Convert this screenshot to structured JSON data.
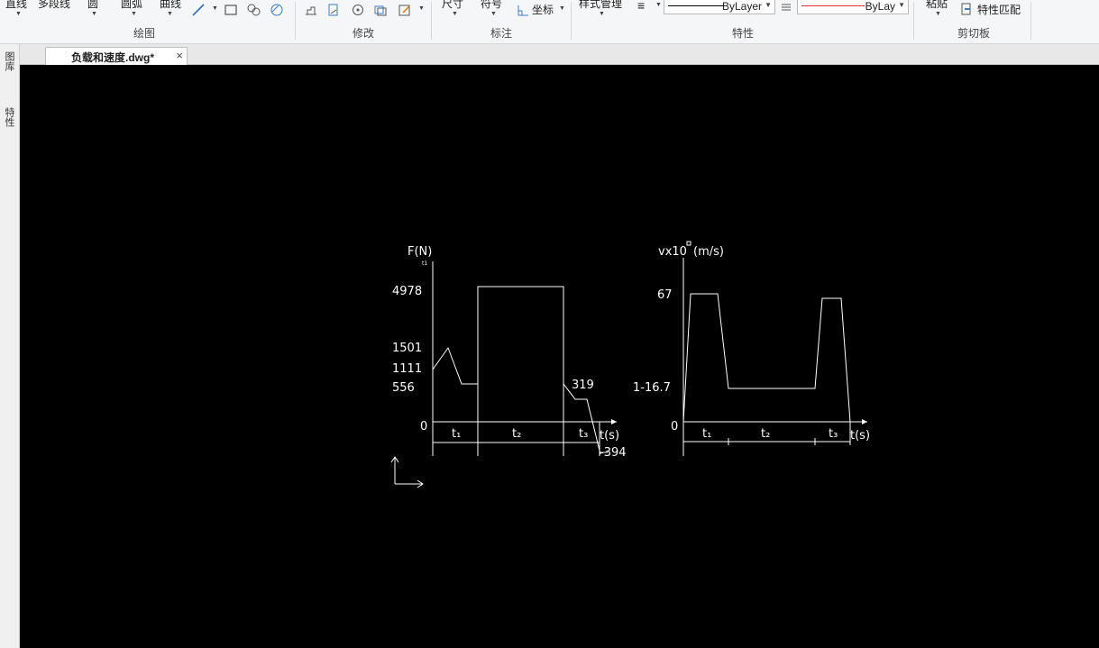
{
  "ribbon": {
    "draw_items": [
      "直线",
      "多段线",
      "圆",
      "圆弧",
      "曲线"
    ],
    "groups": [
      "绘图",
      "修改",
      "标注",
      "特性",
      "剪切板"
    ],
    "annotate_items": [
      "尺寸",
      "符号",
      "坐标"
    ],
    "style_manager": "样式管理",
    "linetype_label": "ByLayer",
    "color_label": "ByLay",
    "color_line": "#e03030",
    "paste": "粘贴",
    "match_properties": "特性匹配"
  },
  "tabs": [
    {
      "label": "负载和速度.dwg*",
      "active": true
    }
  ],
  "left_palette": [
    "图库",
    "特性"
  ],
  "drawing": {
    "force_chart": {
      "ylabel": "F(N)",
      "xlabel": "t(s)",
      "origin": "0",
      "y_ticks": [
        "4978",
        "1501",
        "1111",
        "556"
      ],
      "annotations": [
        "319",
        "-394"
      ],
      "intervals": [
        "t₁",
        "t₂",
        "t₃"
      ],
      "small_mark": "t1"
    },
    "velocity_chart": {
      "ylabel": "vx10",
      "ylabel_unit": "(m/s)",
      "origin": "0",
      "y_ticks": [
        "67",
        "1-16.7"
      ],
      "xlabel": "t(s)",
      "intervals": [
        "t₁",
        "t₂",
        "t₃"
      ]
    }
  }
}
